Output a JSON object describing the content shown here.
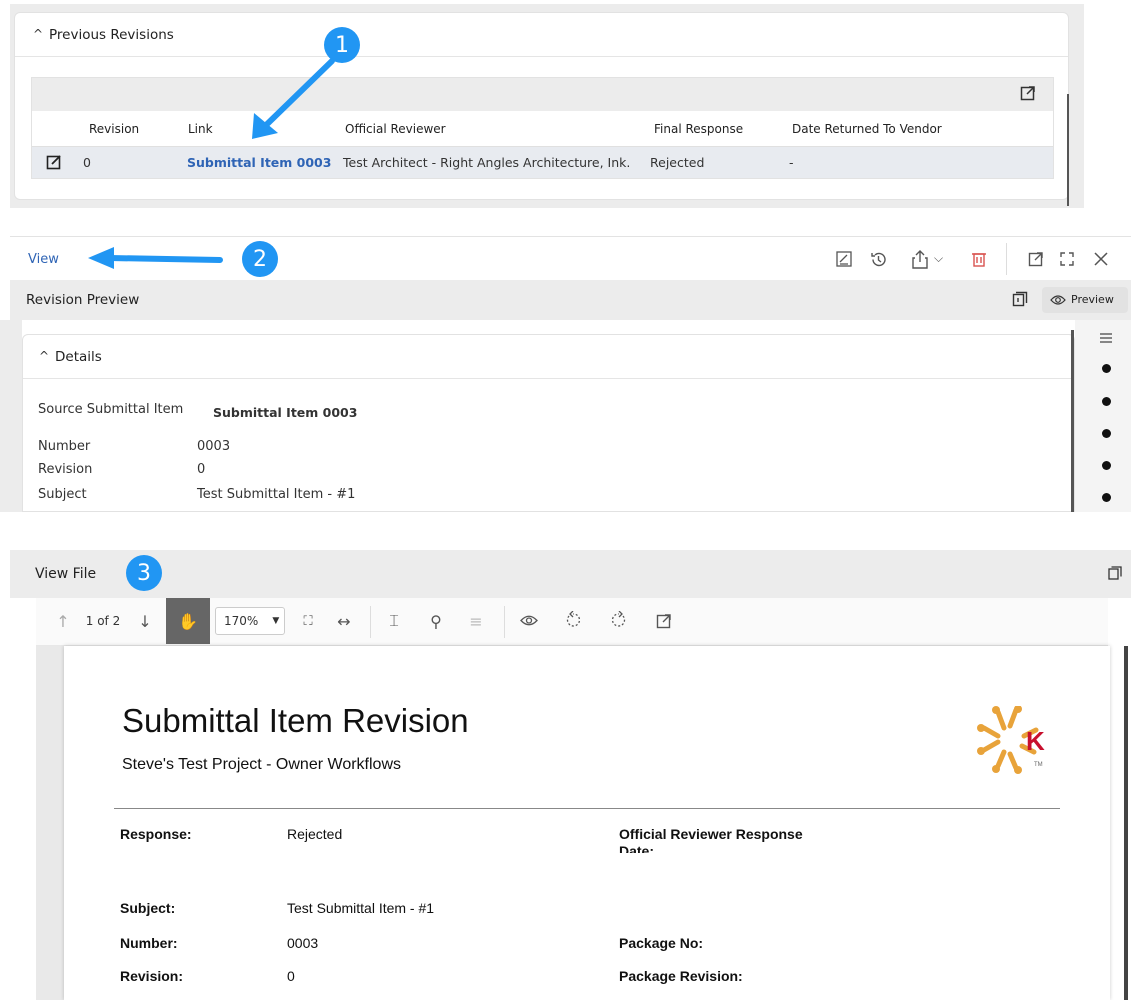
{
  "revisions": {
    "section_title": "Previous Revisions",
    "columns": [
      "Revision",
      "Link",
      "Official Reviewer",
      "Final Response",
      "Date Returned To Vendor"
    ],
    "rows": [
      {
        "revision": "0",
        "link": "Submittal Item 0003",
        "reviewer": "Test Architect - Right Angles Architecture, Ink.",
        "response": "Rejected",
        "date": "-"
      }
    ]
  },
  "callouts": [
    "1",
    "2",
    "3"
  ],
  "view_bar": {
    "view_label": "View"
  },
  "preview": {
    "title": "Revision Preview",
    "preview_label": "Preview"
  },
  "details": {
    "title": "Details",
    "fields": [
      {
        "label": "Source Submittal Item",
        "value": "Submittal Item 0003"
      },
      {
        "label": "Number",
        "value": "0003"
      },
      {
        "label": "Revision",
        "value": "0"
      },
      {
        "label": "Subject",
        "value": "Test Submittal Item - #1"
      }
    ]
  },
  "view_file": {
    "title": "View File",
    "page_indicator": "1 of 2",
    "zoom": "170%"
  },
  "document": {
    "title": "Submittal Item Revision",
    "project": "Steve's Test Project - Owner Workflows",
    "logo_letter": "K",
    "logo_tm": "TM",
    "response_label": "Response:",
    "response_value": "Rejected",
    "reviewer_response_label": "Official Reviewer Response",
    "date_label": "Date:",
    "subject_label": "Subject:",
    "subject_value": "Test Submittal Item - #1",
    "number_label": "Number:",
    "number_value": "0003",
    "package_no_label": "Package No:",
    "revision_label": "Revision:",
    "revision_value": "0",
    "package_rev_label": "Package Revision:"
  },
  "colors": {
    "accent": "#2196f3",
    "link": "#2f64b5",
    "delete": "#d9534f"
  }
}
